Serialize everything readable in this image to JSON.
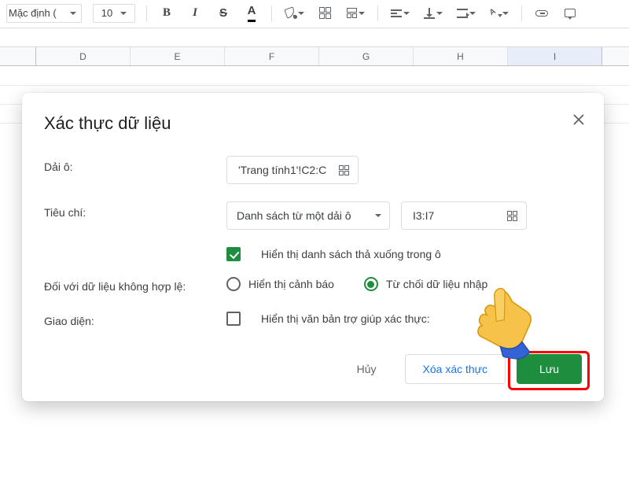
{
  "toolbar": {
    "font_name": "Mặc định (",
    "font_size": "10"
  },
  "columns": [
    "D",
    "E",
    "F",
    "G",
    "H",
    "I"
  ],
  "dialog": {
    "title": "Xác thực dữ liệu",
    "labels": {
      "cell_range": "Dải ô:",
      "criteria": "Tiêu chí:",
      "on_invalid": "Đối với dữ liệu không hợp lệ:",
      "appearance": "Giao diện:"
    },
    "cell_range_value": "'Trang tính1'!C2:C",
    "criteria_type": "Danh sách từ một dải ô",
    "criteria_range": "I3:I7",
    "show_dropdown_label": "Hiển thị danh sách thả xuống trong ô",
    "invalid_show_warning": "Hiển thị cảnh báo",
    "invalid_reject": "Từ chối dữ liệu nhập",
    "show_help_label": "Hiển thị văn bản trợ giúp xác thực:",
    "buttons": {
      "cancel": "Hủy",
      "remove": "Xóa xác thực",
      "save": "Lưu"
    }
  }
}
